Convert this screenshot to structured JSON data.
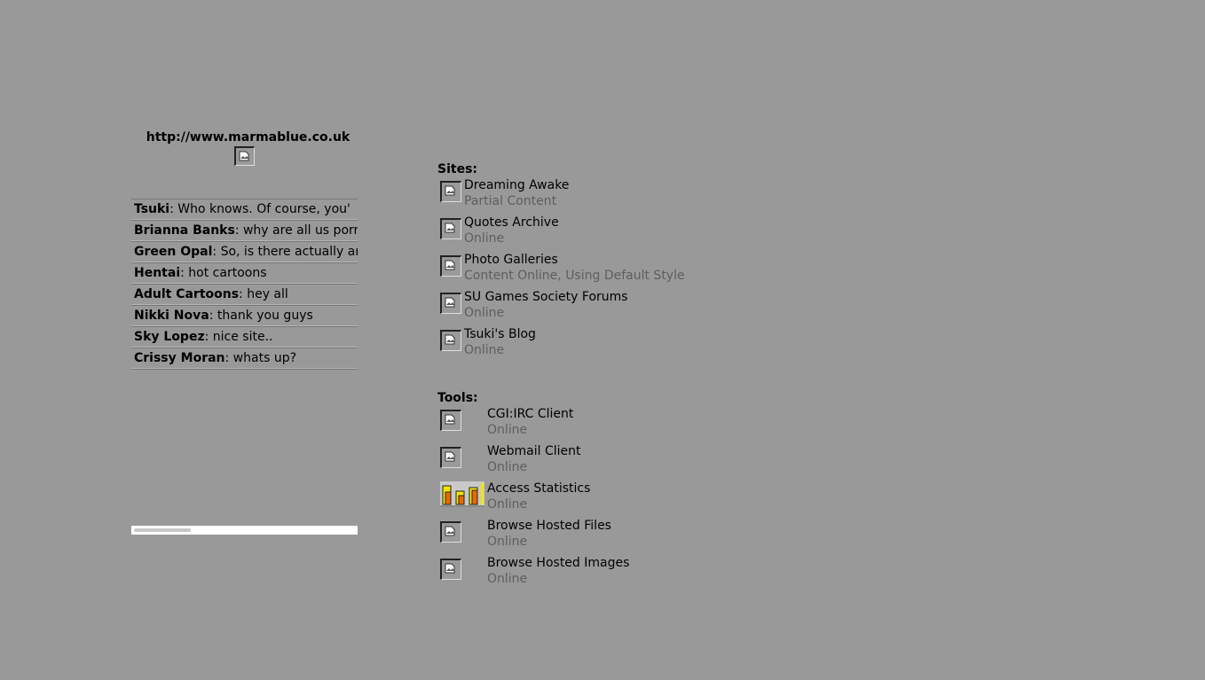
{
  "site_url": "http://www.marmablue.co.uk",
  "logo_icon": "broken-image-icon",
  "chat": {
    "messages": [
      {
        "name": "Tsuki",
        "text": ": Who knows. Of course, you'"
      },
      {
        "name": "Brianna Banks",
        "text": ": why are all us porr"
      },
      {
        "name": "Green Opal",
        "text": ": So, is there actually ar"
      },
      {
        "name": "Hentai",
        "text": ": hot cartoons"
      },
      {
        "name": "Adult Cartoons",
        "text": ": hey all"
      },
      {
        "name": "Nikki Nova",
        "text": ": thank you guys"
      },
      {
        "name": "Sky Lopez",
        "text": ": nice site.."
      },
      {
        "name": "Crissy Moran",
        "text": ": whats up?"
      }
    ],
    "scroll_position": 0.0
  },
  "sites": {
    "title": "Sites:",
    "items": [
      {
        "name": "Dreaming Awake",
        "status": "Partial Content",
        "icon": "broken-image-icon"
      },
      {
        "name": "Quotes Archive",
        "status": "Online",
        "icon": "broken-image-icon"
      },
      {
        "name": "Photo Galleries",
        "status": "Content Online, Using Default Style",
        "icon": "broken-image-icon"
      },
      {
        "name": "SU Games Society Forums",
        "status": "Online",
        "icon": "broken-image-icon"
      },
      {
        "name": "Tsuki's Blog",
        "status": "Online",
        "icon": "broken-image-icon"
      }
    ]
  },
  "tools": {
    "title": "Tools:",
    "items": [
      {
        "name": "CGI:IRC Client",
        "status": "Online",
        "icon": "broken-image-icon"
      },
      {
        "name": "Webmail Client",
        "status": "Online",
        "icon": "broken-image-icon"
      },
      {
        "name": "Access Statistics",
        "status": "Online",
        "icon": "bar-chart-icon"
      },
      {
        "name": "Browse Hosted Files",
        "status": "Online",
        "icon": "broken-image-icon"
      },
      {
        "name": "Browse Hosted Images",
        "status": "Online",
        "icon": "broken-image-icon"
      }
    ]
  },
  "colors": {
    "background": "#999999",
    "status_text": "#5e5e5e",
    "stats_bar_yellow": "#f2e600",
    "stats_bar_orange": "#e86a00"
  }
}
